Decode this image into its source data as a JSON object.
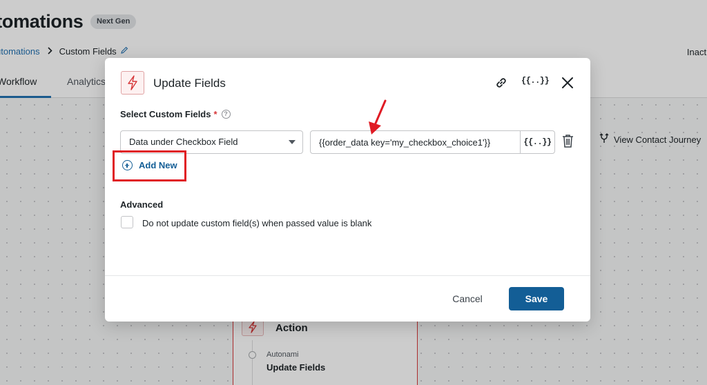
{
  "page": {
    "title": "utomations",
    "badge": "Next Gen",
    "breadcrumb": {
      "parent": "utomations",
      "separator": ">",
      "current": "Custom Fields"
    },
    "status": "Inacti",
    "tabs": [
      "Workflow",
      "Analytics"
    ],
    "view_journey": "View Contact Journey"
  },
  "action_card": {
    "title": "Action",
    "subtitle": "Autonami",
    "name": "Update Fields"
  },
  "modal": {
    "title": "Update Fields",
    "merge_tag_label": "{{..}}",
    "field_label": "Select Custom Fields",
    "required_mark": "*",
    "help_mark": "?",
    "select_value": "Data under Checkbox Field",
    "value_input": "{{order_data key='my_checkbox_choice1'}}",
    "value_merge_label": "{{..}}",
    "add_new": "Add New",
    "advanced_label": "Advanced",
    "checkbox_label": "Do not update custom field(s) when passed value is blank",
    "checkbox_checked": false,
    "cancel_label": "Cancel",
    "save_label": "Save"
  },
  "colors": {
    "accent": "#135e96",
    "link": "#2271b1",
    "danger": "#d63638",
    "annotation": "#e01b24"
  },
  "icons": {
    "action": "lightning-icon",
    "link": "link-icon",
    "close": "close-icon",
    "delete": "trash-icon",
    "journey": "branch-icon",
    "edit": "pencil-icon"
  }
}
